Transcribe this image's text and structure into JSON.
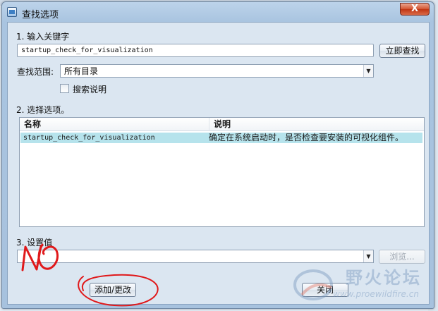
{
  "window": {
    "title": "查找选项",
    "close_symbol": "X"
  },
  "keyword": {
    "step_label": "1.  输入关键字",
    "value": "startup_check_for_visualization",
    "find_button": "立即查找"
  },
  "scope": {
    "label": "查找范围:",
    "selected": "所有目录",
    "search_desc_label": "搜索说明",
    "search_desc_checked": false
  },
  "options": {
    "step_label": "2.  选择选项。",
    "columns": [
      "名称",
      "说明"
    ],
    "rows": [
      {
        "name": "startup_check_for_visualization",
        "desc": "确定在系统启动时，是否检查要安装的可视化组件。"
      }
    ]
  },
  "set_value": {
    "step_label": "3.  设置值",
    "value": "",
    "browse_button": "浏览...",
    "add_change_button": "添加/更改",
    "close_button": "关闭"
  },
  "handwritten_annotation": "NO",
  "watermark": {
    "site_name": "野火论坛",
    "url": "www.proewildfire.cn"
  },
  "colors": {
    "selection": "#b6e3ec",
    "annotation_red": "#e0191b",
    "title_gradient": "#bcd3ea"
  }
}
